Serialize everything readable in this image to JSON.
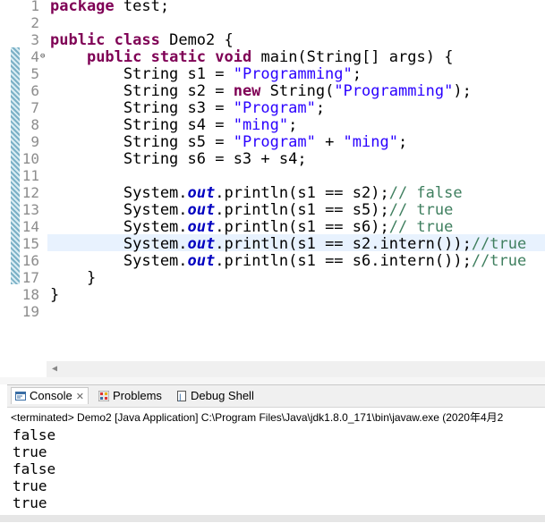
{
  "editor": {
    "lines": [
      {
        "n": "1",
        "parts": [
          {
            "t": "package",
            "c": "kw"
          },
          {
            "t": " test;",
            "c": ""
          }
        ]
      },
      {
        "n": "2",
        "parts": []
      },
      {
        "n": "3",
        "parts": [
          {
            "t": "public",
            "c": "kw"
          },
          {
            "t": " ",
            "c": ""
          },
          {
            "t": "class",
            "c": "kw"
          },
          {
            "t": " Demo2 {",
            "c": ""
          }
        ]
      },
      {
        "n": "4",
        "fold": "⊖",
        "parts": [
          {
            "t": "    ",
            "c": ""
          },
          {
            "t": "public",
            "c": "kw"
          },
          {
            "t": " ",
            "c": ""
          },
          {
            "t": "static",
            "c": "kw"
          },
          {
            "t": " ",
            "c": ""
          },
          {
            "t": "void",
            "c": "kw"
          },
          {
            "t": " main(String[] ",
            "c": ""
          },
          {
            "t": "args",
            "c": ""
          },
          {
            "t": ") {",
            "c": ""
          }
        ]
      },
      {
        "n": "5",
        "parts": [
          {
            "t": "        String s1 = ",
            "c": ""
          },
          {
            "t": "\"Programming\"",
            "c": "str"
          },
          {
            "t": ";",
            "c": ""
          }
        ]
      },
      {
        "n": "6",
        "parts": [
          {
            "t": "        String s2 = ",
            "c": ""
          },
          {
            "t": "new",
            "c": "kw"
          },
          {
            "t": " String(",
            "c": ""
          },
          {
            "t": "\"Programming\"",
            "c": "str"
          },
          {
            "t": ");",
            "c": ""
          }
        ]
      },
      {
        "n": "7",
        "parts": [
          {
            "t": "        String s3 = ",
            "c": ""
          },
          {
            "t": "\"Program\"",
            "c": "str"
          },
          {
            "t": ";",
            "c": ""
          }
        ]
      },
      {
        "n": "8",
        "parts": [
          {
            "t": "        String s4 = ",
            "c": ""
          },
          {
            "t": "\"ming\"",
            "c": "str"
          },
          {
            "t": ";",
            "c": ""
          }
        ]
      },
      {
        "n": "9",
        "parts": [
          {
            "t": "        String s5 = ",
            "c": ""
          },
          {
            "t": "\"Program\"",
            "c": "str"
          },
          {
            "t": " + ",
            "c": ""
          },
          {
            "t": "\"ming\"",
            "c": "str"
          },
          {
            "t": ";",
            "c": ""
          }
        ]
      },
      {
        "n": "10",
        "parts": [
          {
            "t": "        String s6 = s3 + s4;",
            "c": ""
          }
        ]
      },
      {
        "n": "11",
        "parts": []
      },
      {
        "n": "12",
        "parts": [
          {
            "t": "        System.",
            "c": ""
          },
          {
            "t": "out",
            "c": "fld"
          },
          {
            "t": ".println(s1 == s2);",
            "c": ""
          },
          {
            "t": "// false",
            "c": "cm"
          }
        ]
      },
      {
        "n": "13",
        "parts": [
          {
            "t": "        System.",
            "c": ""
          },
          {
            "t": "out",
            "c": "fld"
          },
          {
            "t": ".println(s1 == s5);",
            "c": ""
          },
          {
            "t": "// true",
            "c": "cm"
          }
        ]
      },
      {
        "n": "14",
        "parts": [
          {
            "t": "        System.",
            "c": ""
          },
          {
            "t": "out",
            "c": "fld"
          },
          {
            "t": ".println(s1 == s6);",
            "c": ""
          },
          {
            "t": "// true",
            "c": "cm"
          }
        ]
      },
      {
        "n": "15",
        "parts": [
          {
            "t": "        System.",
            "c": ""
          },
          {
            "t": "out",
            "c": "fld"
          },
          {
            "t": ".println(s1 == s2.intern());",
            "c": ""
          },
          {
            "t": "//true",
            "c": "cm"
          }
        ]
      },
      {
        "n": "16",
        "parts": [
          {
            "t": "        System.",
            "c": ""
          },
          {
            "t": "out",
            "c": "fld"
          },
          {
            "t": ".println(s1 == s6.intern());",
            "c": ""
          },
          {
            "t": "//true",
            "c": "cm"
          }
        ]
      },
      {
        "n": "17",
        "parts": [
          {
            "t": "    }",
            "c": ""
          }
        ]
      },
      {
        "n": "18",
        "parts": [
          {
            "t": "}",
            "c": ""
          }
        ]
      },
      {
        "n": "19",
        "parts": []
      }
    ]
  },
  "panel": {
    "tabs": [
      {
        "label": "Console",
        "icon": "console-icon",
        "active": true,
        "close": "✕"
      },
      {
        "label": "Problems",
        "icon": "problems-icon",
        "active": false
      },
      {
        "label": "Debug Shell",
        "icon": "debug-shell-icon",
        "active": false
      }
    ],
    "status": "<terminated> Demo2 [Java Application] C:\\Program Files\\Java\\jdk1.8.0_171\\bin\\javaw.exe (2020年4月2",
    "output": [
      "false",
      "true",
      "false",
      "true",
      "true"
    ]
  },
  "colors": {
    "keyword": "#7f0055",
    "string": "#2a00ff",
    "comment": "#3f7f5f",
    "field": "#0000c0"
  }
}
